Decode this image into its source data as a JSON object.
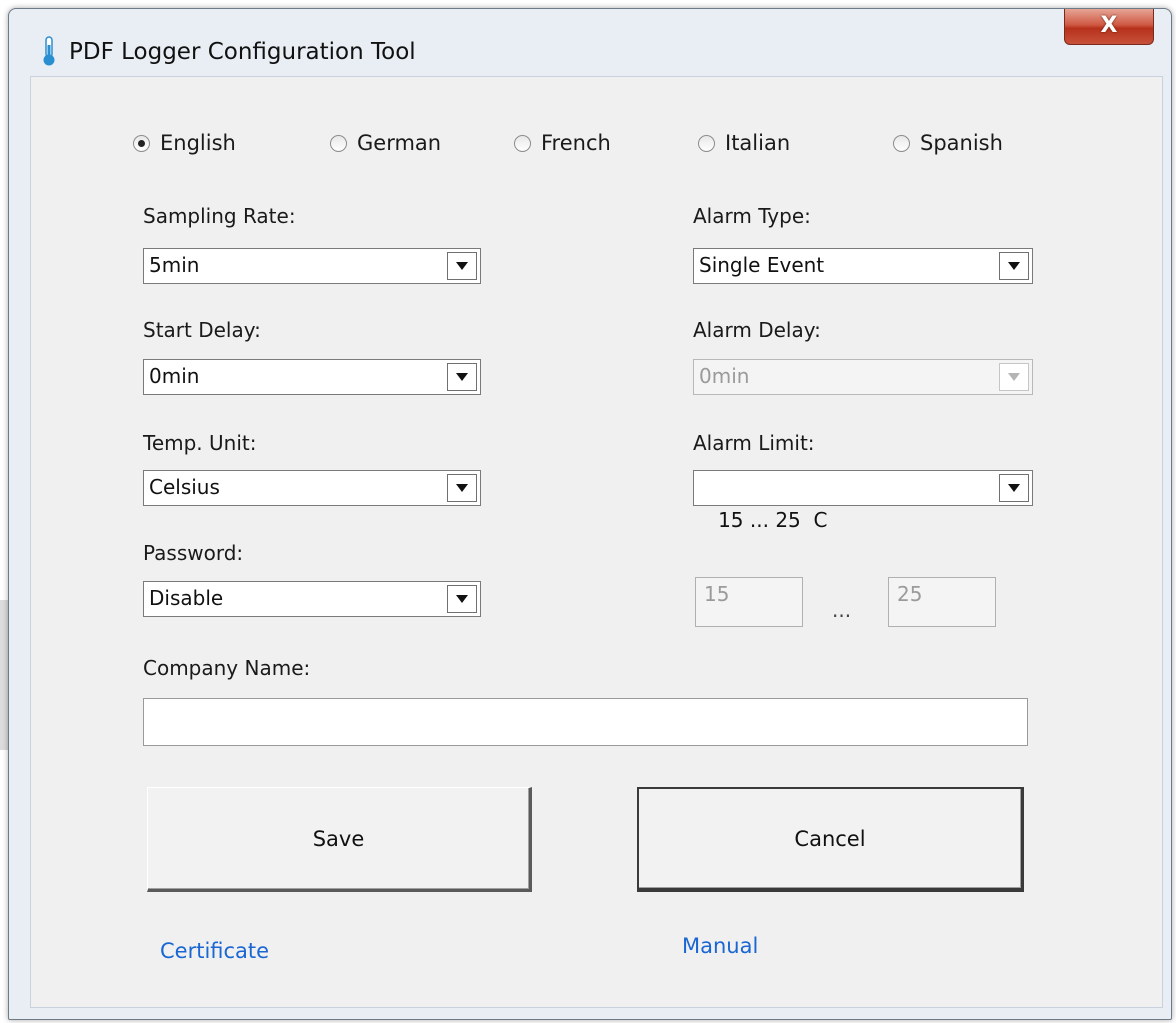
{
  "window": {
    "title": "PDF Logger Configuration Tool",
    "close_label": "X"
  },
  "languages": [
    {
      "label": "English",
      "selected": true
    },
    {
      "label": "German",
      "selected": false
    },
    {
      "label": "French",
      "selected": false
    },
    {
      "label": "Italian",
      "selected": false
    },
    {
      "label": "Spanish",
      "selected": false
    }
  ],
  "fields": {
    "sampling_rate": {
      "label": "Sampling Rate:",
      "value": "5min"
    },
    "start_delay": {
      "label": "Start Delay:",
      "value": "0min"
    },
    "temp_unit": {
      "label": "Temp. Unit:",
      "value": "Celsius"
    },
    "password": {
      "label": "Password:",
      "value": "Disable"
    },
    "alarm_type": {
      "label": "Alarm Type:",
      "value": "Single Event"
    },
    "alarm_delay": {
      "label": "Alarm Delay:",
      "value": "0min",
      "disabled": true
    },
    "alarm_limit": {
      "label": "Alarm Limit:",
      "value": " 15 ... 25  C"
    },
    "limit_low": {
      "value": "15"
    },
    "limit_separator": "...",
    "limit_high": {
      "value": "25"
    },
    "company_name": {
      "label": "Company Name:",
      "value": ""
    }
  },
  "buttons": {
    "save": "Save",
    "cancel": "Cancel"
  },
  "links": {
    "certificate": "Certificate",
    "manual": "Manual"
  },
  "colors": {
    "link": "#1a66d2",
    "close_button": "#c8503a",
    "window_bg": "#f0f0f0"
  }
}
